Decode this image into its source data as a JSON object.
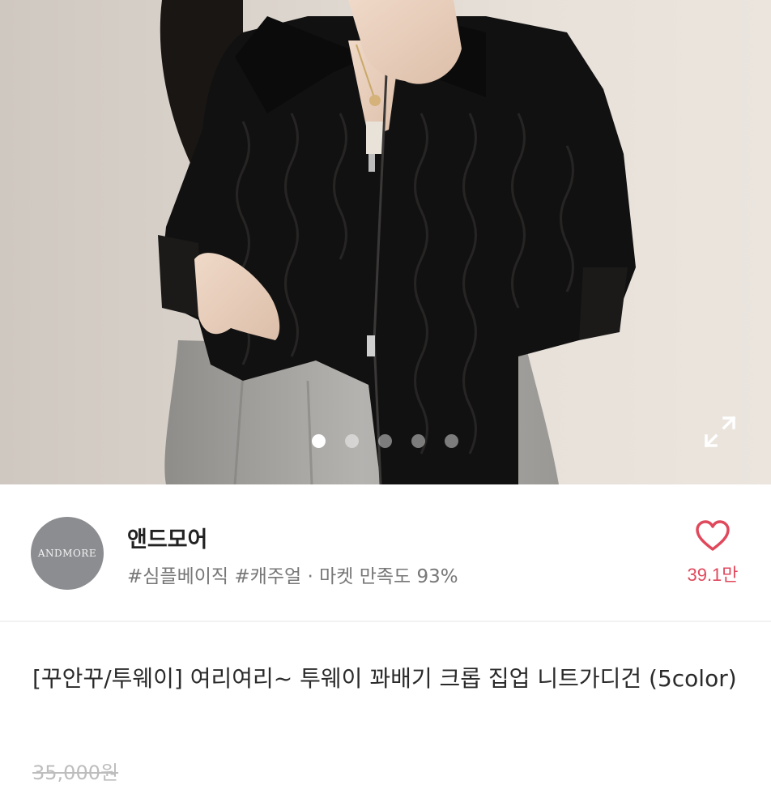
{
  "gallery": {
    "image_alt": "black cable knit two-way zip-up crop cardigan product photo",
    "dot_count": 5,
    "active_dot": 1,
    "expand_icon": "expand-arrows-icon"
  },
  "shop": {
    "logo_text": "ANDMORE",
    "name": "앤드모어",
    "tags": "#심플베이직 #캐주얼 · 마켓 만족도 93%",
    "like_icon": "heart-outline-icon",
    "like_count": "39.1만",
    "accent_color": "#e0485c"
  },
  "product": {
    "title": "[꾸안꾸/투웨이] 여리여리~ 투웨이 꽈배기 크롭 집업 니트가디건 (5color)",
    "price": "35,000원"
  }
}
